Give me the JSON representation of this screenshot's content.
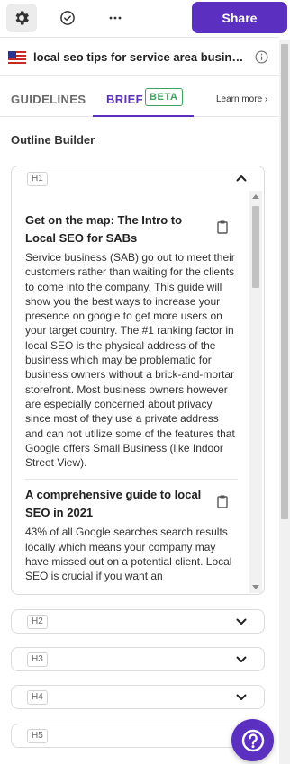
{
  "toolbar": {
    "icons": [
      "gear-icon",
      "check-circle-icon",
      "more-dots-icon"
    ],
    "share_label": "Share"
  },
  "query": {
    "flag": "us-flag-icon",
    "text": "local seo tips for service area businesses",
    "info_icon": "info-icon"
  },
  "tabs": {
    "guidelines": "GUIDELINES",
    "brief": "BRIEF",
    "beta": "BETA",
    "learn_more": "Learn more ›",
    "active": "brief"
  },
  "outline": {
    "title": "Outline Builder",
    "sections": [
      {
        "tag": "H1",
        "expanded": true,
        "items": [
          {
            "title": "Get on the map: The Intro to Local SEO for SABs",
            "body": "Service business (SAB) go out to meet their customers rather than waiting for the clients to come into the company. This guide will show you the best ways to increase your presence on google to get more users on your target country. The #1 ranking factor in local SEO is the physical address of the business which may be problematic for business owners without a brick-and-mortar storefront. Most business owners however are especially concerned about privacy since most of they use a private address and can not utilize some of the features that Google offers Small Business (like Indoor Street View)."
          },
          {
            "title": "A comprehensive guide to local SEO in 2021",
            "body": "43% of all Google searches search results locally which means your company may have missed out on a potential client. Local SEO is crucial if you want an"
          }
        ]
      },
      {
        "tag": "H2",
        "expanded": false
      },
      {
        "tag": "H3",
        "expanded": false
      },
      {
        "tag": "H4",
        "expanded": false
      },
      {
        "tag": "H5",
        "expanded": false
      }
    ]
  },
  "help_icon": "question-mark-icon",
  "colors": {
    "accent": "#5b2fbf",
    "beta_green": "#3aa35d",
    "border": "#dcdcdc"
  }
}
